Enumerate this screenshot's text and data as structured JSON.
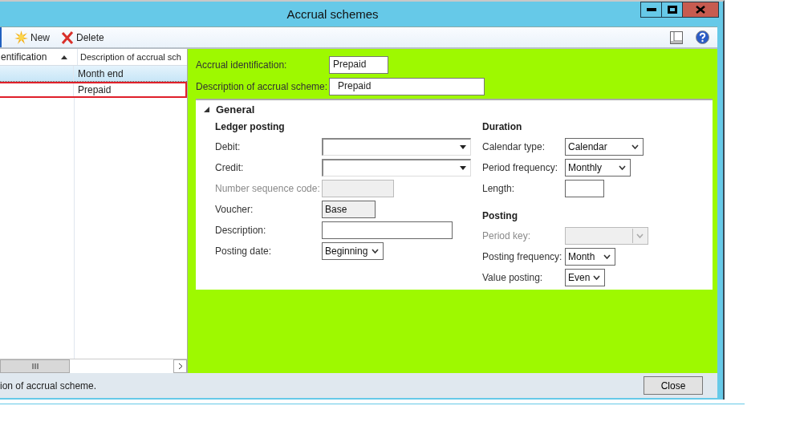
{
  "window": {
    "title": "Accrual schemes"
  },
  "toolbar": {
    "buttons": [
      {
        "kind": "new",
        "label": "New"
      },
      {
        "kind": "delete",
        "label": "Delete"
      }
    ]
  },
  "grid": {
    "columns": [
      {
        "label": "entification",
        "sorted": true
      },
      {
        "label": "Description of accrual sch",
        "sorted": false
      }
    ],
    "rows": [
      {
        "cells": [
          "",
          "Month end"
        ],
        "selected": true,
        "focused": false
      },
      {
        "cells": [
          "",
          "Prepaid"
        ],
        "selected": false,
        "focused": true
      }
    ]
  },
  "header_fields": [
    {
      "label": "Accrual identification:",
      "value": "Prepaid"
    },
    {
      "label": "Description of accrual scheme:",
      "value": "Prepaid"
    }
  ],
  "section": {
    "title": "General",
    "expanded": true,
    "groups": [
      {
        "title": "Ledger posting",
        "fields": [
          {
            "label": "Debit:",
            "kind": "combo",
            "disabled": false
          },
          {
            "label": "Credit:",
            "kind": "combo",
            "disabled": false
          },
          {
            "label": "Number sequence code:",
            "kind": "text",
            "disabled": true
          },
          {
            "label": "Voucher:",
            "kind": "readonly",
            "value": "Base",
            "disabled": false
          },
          {
            "label": "Description:",
            "kind": "text",
            "disabled": false
          },
          {
            "label": "Posting date:",
            "kind": "select",
            "value": "Beginning",
            "disabled": false
          }
        ]
      },
      {
        "title": "Duration",
        "fields": [
          {
            "label": "Calendar type:",
            "kind": "select",
            "value": "Calendar",
            "disabled": false
          },
          {
            "label": "Period frequency:",
            "kind": "select",
            "value": "Monthly",
            "disabled": false
          },
          {
            "label": "Length:",
            "kind": "text",
            "disabled": false
          }
        ]
      },
      {
        "title": "Posting",
        "fields": [
          {
            "label": "Period key:",
            "kind": "select",
            "disabled": true
          },
          {
            "label": "Posting frequency:",
            "kind": "select",
            "value": "Month",
            "disabled": false
          },
          {
            "label": "Value posting:",
            "kind": "select",
            "value": "Even",
            "disabled": false
          }
        ]
      }
    ]
  },
  "status_bar": {
    "text": "ion of accrual scheme.",
    "button": "Close"
  }
}
